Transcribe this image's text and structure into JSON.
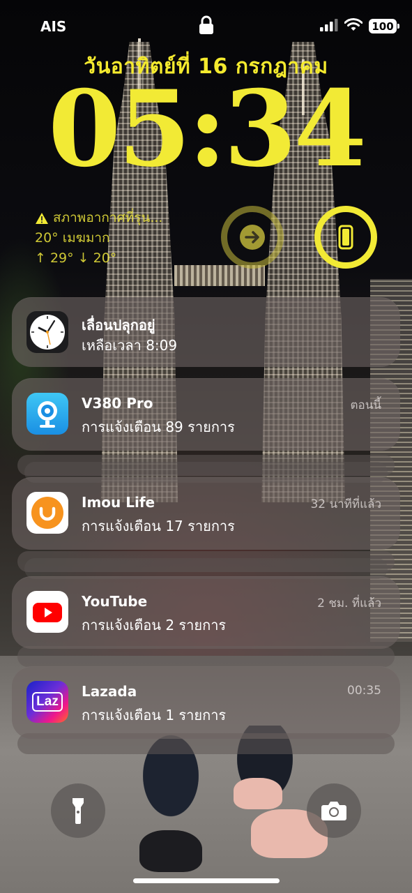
{
  "status_bar": {
    "carrier": "AIS",
    "battery": "100",
    "icons": [
      "lock-icon",
      "cellular-signal-icon",
      "wifi-icon",
      "battery-icon"
    ]
  },
  "lock_screen": {
    "date": "วันอาทิตย์ที่ 16 กรกฎาคม",
    "time": "05:34",
    "accent_color": "#f2ea35"
  },
  "widgets": {
    "weather": {
      "alert": "สภาพอากาศที่รุน...",
      "current": "20° เมฆมาก",
      "range": "↑ 29° ↓ 20°",
      "icon": "warning-icon"
    },
    "shortcut": {
      "icon": "arrow-right-circle-icon"
    },
    "device_battery": {
      "icon": "phone-battery-icon"
    }
  },
  "notifications": [
    {
      "app": "Clock",
      "title": "เลื่อนปลุกอยู่",
      "body": "เหลือเวลา 8:09",
      "time": "",
      "icon": "clock-app-icon"
    },
    {
      "app": "V380 Pro",
      "title": "V380 Pro",
      "body": "การแจ้งเตือน 89 รายการ",
      "time": "ตอนนี้",
      "icon": "v380-app-icon"
    },
    {
      "app": "Imou Life",
      "title": "Imou Life",
      "body": "การแจ้งเตือน 17 รายการ",
      "time": "32 นาทีที่แล้ว",
      "icon": "imou-app-icon"
    },
    {
      "app": "YouTube",
      "title": "YouTube",
      "body": "การแจ้งเตือน 2 รายการ",
      "time": "2 ชม. ที่แล้ว",
      "icon": "youtube-app-icon"
    },
    {
      "app": "Lazada",
      "title": "Lazada",
      "body": "การแจ้งเตือน 1 รายการ",
      "time": "00:35",
      "icon": "lazada-app-icon",
      "icon_text": "Laz"
    }
  ],
  "bottom_controls": {
    "flashlight": {
      "icon": "flashlight-icon"
    },
    "camera": {
      "icon": "camera-icon"
    }
  }
}
